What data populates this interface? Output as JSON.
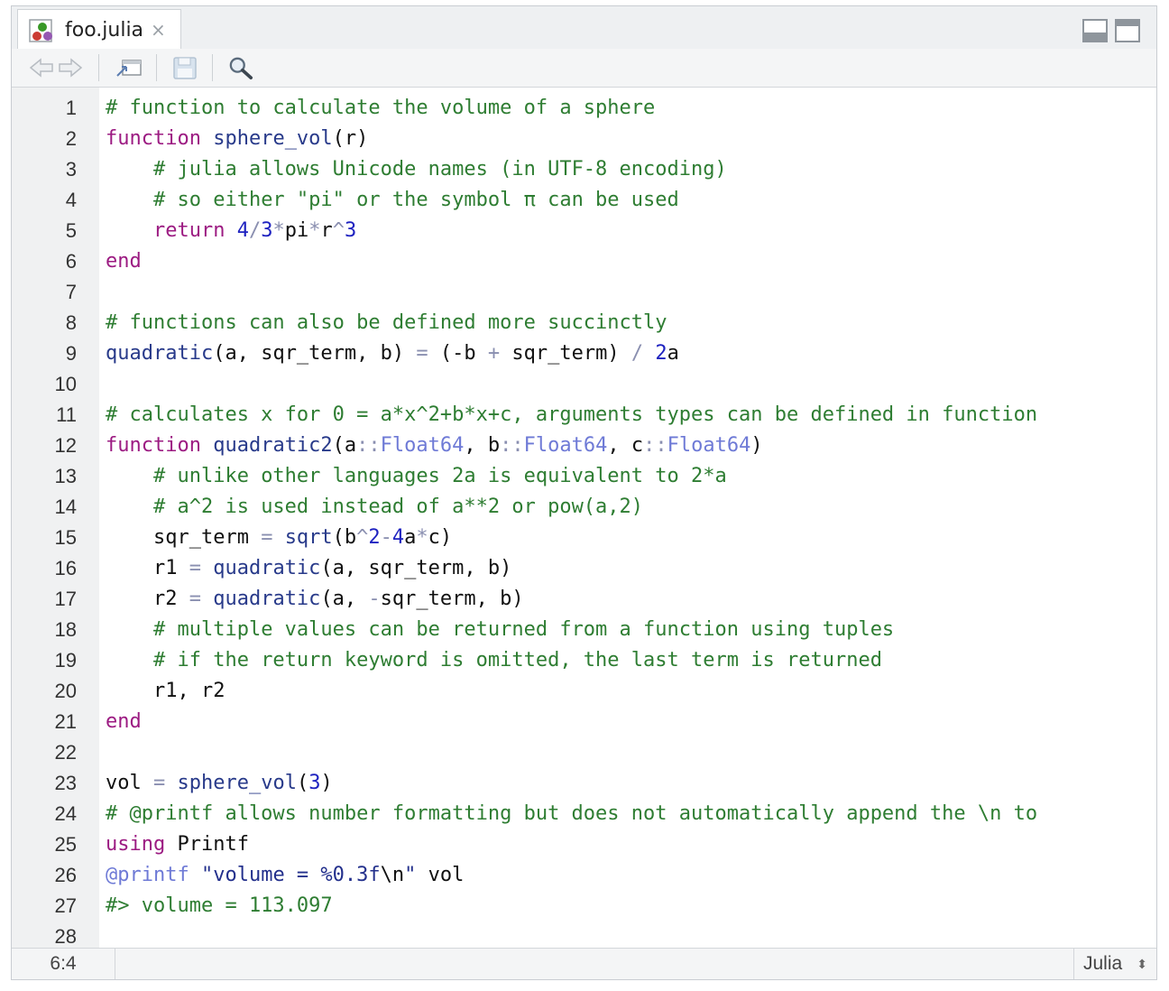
{
  "tab": {
    "title": "foo.julia",
    "close_glyph": "×"
  },
  "toolbar": {
    "icons": [
      "back-arrow-icon",
      "forward-arrow-icon",
      "show-in-window-icon",
      "save-icon",
      "search-icon"
    ]
  },
  "editor": {
    "lines": [
      [
        [
          "c",
          "# function to calculate the volume of a sphere"
        ]
      ],
      [
        [
          "k",
          "function"
        ],
        [
          "v",
          " "
        ],
        [
          "f",
          "sphere_vol"
        ],
        [
          "v",
          "(r)"
        ]
      ],
      [
        [
          "v",
          "    "
        ],
        [
          "c",
          "# julia allows Unicode names (in UTF-8 encoding)"
        ]
      ],
      [
        [
          "v",
          "    "
        ],
        [
          "c",
          "# so either \"pi\" or the symbol π can be used"
        ]
      ],
      [
        [
          "v",
          "    "
        ],
        [
          "k",
          "return"
        ],
        [
          "v",
          " "
        ],
        [
          "n",
          "4"
        ],
        [
          "o",
          "/"
        ],
        [
          "n",
          "3"
        ],
        [
          "o",
          "*"
        ],
        [
          "v",
          "pi"
        ],
        [
          "o",
          "*"
        ],
        [
          "v",
          "r"
        ],
        [
          "o",
          "^"
        ],
        [
          "n",
          "3"
        ]
      ],
      [
        [
          "k",
          "end"
        ]
      ],
      [],
      [
        [
          "c",
          "# functions can also be defined more succinctly"
        ]
      ],
      [
        [
          "f",
          "quadratic"
        ],
        [
          "v",
          "(a, sqr_term, b) "
        ],
        [
          "o",
          "="
        ],
        [
          "v",
          " (-b "
        ],
        [
          "o",
          "+"
        ],
        [
          "v",
          " sqr_term) "
        ],
        [
          "o",
          "/"
        ],
        [
          "v",
          " "
        ],
        [
          "n",
          "2"
        ],
        [
          "v",
          "a"
        ]
      ],
      [],
      [
        [
          "c",
          "# calculates x for 0 = a*x^2+b*x+c, arguments types can be defined in function"
        ]
      ],
      [
        [
          "k",
          "function"
        ],
        [
          "v",
          " "
        ],
        [
          "f",
          "quadratic2"
        ],
        [
          "v",
          "(a"
        ],
        [
          "o",
          "::"
        ],
        [
          "t",
          "Float64"
        ],
        [
          "v",
          ", b"
        ],
        [
          "o",
          "::"
        ],
        [
          "t",
          "Float64"
        ],
        [
          "v",
          ", c"
        ],
        [
          "o",
          "::"
        ],
        [
          "t",
          "Float64"
        ],
        [
          "v",
          ")"
        ]
      ],
      [
        [
          "v",
          "    "
        ],
        [
          "c",
          "# unlike other languages 2a is equivalent to 2*a"
        ]
      ],
      [
        [
          "v",
          "    "
        ],
        [
          "c",
          "# a^2 is used instead of a**2 or pow(a,2)"
        ]
      ],
      [
        [
          "v",
          "    sqr_term "
        ],
        [
          "o",
          "="
        ],
        [
          "v",
          " "
        ],
        [
          "f",
          "sqrt"
        ],
        [
          "v",
          "(b"
        ],
        [
          "o",
          "^"
        ],
        [
          "n",
          "2"
        ],
        [
          "o",
          "-"
        ],
        [
          "n",
          "4"
        ],
        [
          "v",
          "a"
        ],
        [
          "o",
          "*"
        ],
        [
          "v",
          "c)"
        ]
      ],
      [
        [
          "v",
          "    r1 "
        ],
        [
          "o",
          "="
        ],
        [
          "v",
          " "
        ],
        [
          "f",
          "quadratic"
        ],
        [
          "v",
          "(a, sqr_term, b)"
        ]
      ],
      [
        [
          "v",
          "    r2 "
        ],
        [
          "o",
          "="
        ],
        [
          "v",
          " "
        ],
        [
          "f",
          "quadratic"
        ],
        [
          "v",
          "(a, "
        ],
        [
          "o",
          "-"
        ],
        [
          "v",
          "sqr_term, b)"
        ]
      ],
      [
        [
          "v",
          "    "
        ],
        [
          "c",
          "# multiple values can be returned from a function using tuples"
        ]
      ],
      [
        [
          "v",
          "    "
        ],
        [
          "c",
          "# if the return keyword is omitted, the last term is returned"
        ]
      ],
      [
        [
          "v",
          "    r1, r2"
        ]
      ],
      [
        [
          "k",
          "end"
        ]
      ],
      [],
      [
        [
          "v",
          "vol "
        ],
        [
          "o",
          "="
        ],
        [
          "v",
          " "
        ],
        [
          "f",
          "sphere_vol"
        ],
        [
          "v",
          "("
        ],
        [
          "n",
          "3"
        ],
        [
          "v",
          ")"
        ]
      ],
      [
        [
          "c",
          "# @printf allows number formatting but does not automatically append the \\n to"
        ]
      ],
      [
        [
          "k",
          "using"
        ],
        [
          "v",
          " Printf"
        ]
      ],
      [
        [
          "t",
          "@printf"
        ],
        [
          "v",
          " "
        ],
        [
          "s",
          "\"volume = %0.3f"
        ],
        [
          "v",
          "\\n"
        ],
        [
          "s",
          "\""
        ],
        [
          "v",
          " vol"
        ]
      ],
      [
        [
          "c",
          "#> volume = 113.097"
        ]
      ],
      []
    ]
  },
  "status": {
    "cursor": "6:4",
    "language": "Julia",
    "language_caret": "⬍"
  }
}
